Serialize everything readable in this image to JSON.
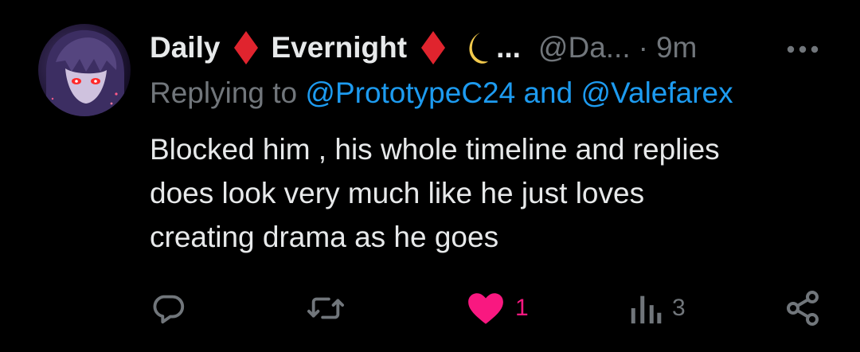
{
  "tweet": {
    "name_first": "Daily",
    "name_second": "Evernight",
    "name_ellipsis": "...",
    "handle": "@Da...",
    "separator": "·",
    "time": "9m",
    "replying_prefix": "Replying to",
    "replying_handle_1": "@PrototypeC24",
    "replying_joiner": "and",
    "replying_handle_2": "@Valefarex",
    "body_lines": [
      "Blocked him , his whole timeline and replies",
      "does look very much like he just loves",
      "creating drama as he goes"
    ]
  },
  "actions": {
    "like_count": "1",
    "views_count": "3"
  },
  "icons": {
    "avatar": "avatar-anime-character",
    "diamond": "red-diamond-icon",
    "moon": "crescent-moon-icon",
    "more": "more-dots-icon",
    "reply": "reply-icon",
    "retweet": "retweet-icon",
    "like": "heart-icon",
    "views": "views-chart-icon",
    "share": "share-icon"
  },
  "colors": {
    "background": "#000000",
    "text": "#e7e9ea",
    "muted": "#71767b",
    "link": "#1d9bf0",
    "like": "#f91880",
    "diamond": "#e0242e",
    "moon": "#f2c94c"
  }
}
